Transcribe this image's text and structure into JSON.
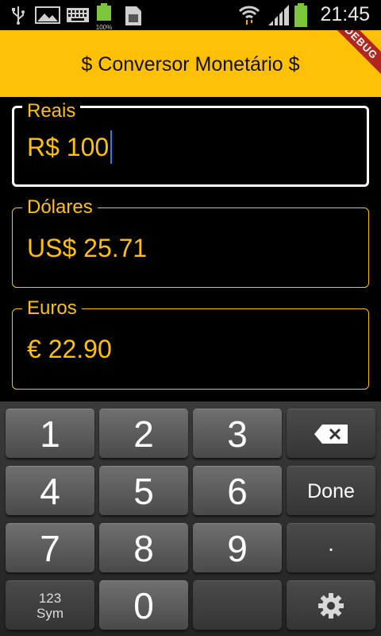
{
  "status_bar": {
    "time": "21:45",
    "battery_small_label": "100%",
    "icons": [
      "usb-icon",
      "image-icon",
      "keyboard-icon",
      "battery-full-icon",
      "sim-icon",
      "wifi-icon",
      "signal-icon",
      "battery-icon"
    ]
  },
  "app_bar": {
    "title": "$ Conversor Monetário $",
    "debug_banner": "DEBUG",
    "background": "#ffc107"
  },
  "fields": {
    "reais": {
      "label": "Reais",
      "value": "R$ 100"
    },
    "dolares": {
      "label": "Dólares",
      "value": "US$ 25.71"
    },
    "euros": {
      "label": "Euros",
      "value": "€ 22.90"
    }
  },
  "keyboard": {
    "keys": {
      "k1": "1",
      "k2": "2",
      "k3": "3",
      "k4": "4",
      "k5": "5",
      "k6": "6",
      "k7": "7",
      "k8": "8",
      "k9": "9",
      "k0": "0",
      "done": "Done",
      "dot": ".",
      "sym_top": "123",
      "sym_bottom": "Sym"
    },
    "icons": {
      "backspace": "backspace-icon",
      "settings": "gear-icon"
    }
  },
  "colors": {
    "accent": "#ffc107",
    "cursor": "#2f7de1",
    "background": "#000000"
  }
}
